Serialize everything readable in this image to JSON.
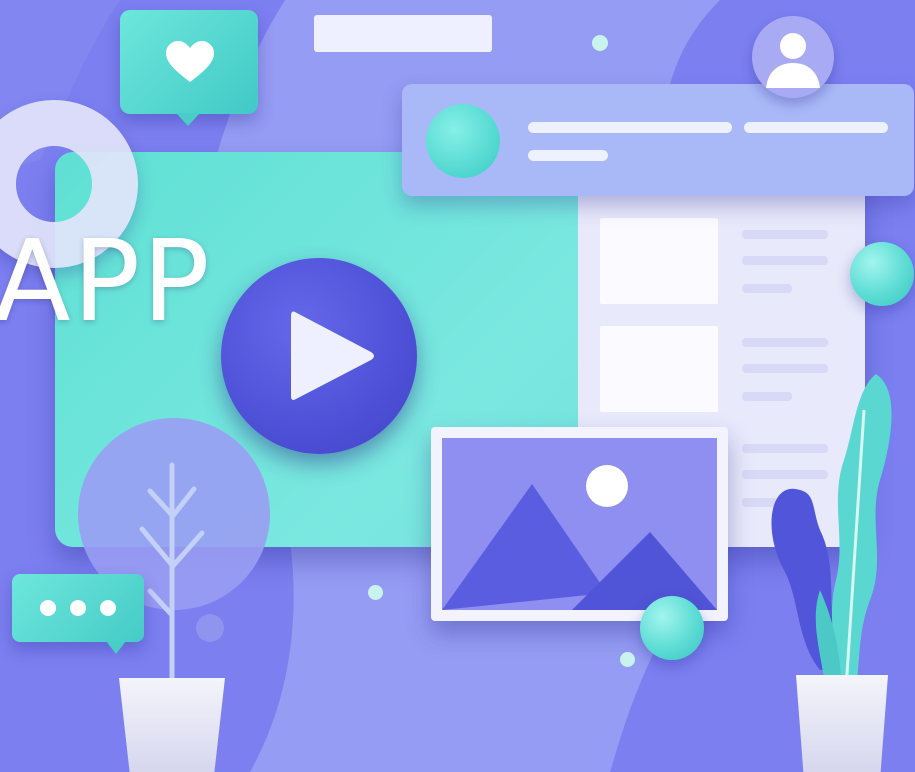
{
  "illustration": {
    "label": "APP",
    "icons": {
      "play": "play-icon",
      "heart": "heart-icon",
      "user": "user-icon",
      "image": "image-icon",
      "chat": "chat-icon",
      "plant": "plant-icon"
    }
  },
  "colors": {
    "background": "#7b7ff0",
    "teal_accent": "#5fe0d4",
    "play_button": "#4c4fd6",
    "card": "#a9b9f8",
    "panel": "#e8e9fb",
    "white": "#ffffff"
  }
}
